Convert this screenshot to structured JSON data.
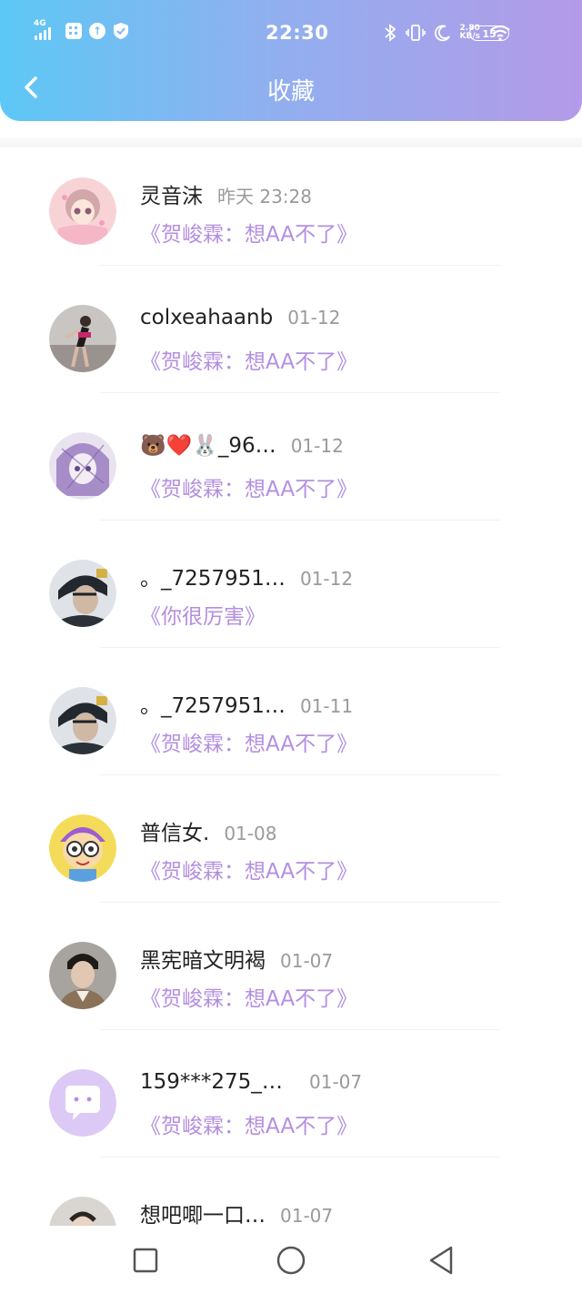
{
  "status_bar": {
    "network": "4G",
    "time": "22:30",
    "net_speed_value": "2.80",
    "net_speed_unit": "KB/s",
    "battery": "15"
  },
  "header": {
    "title": "收藏"
  },
  "items": [
    {
      "name": "灵音沫",
      "time": "昨天 23:28",
      "work": "《贺峻霖：想AA不了》"
    },
    {
      "name": "colxeahaanb",
      "time": "01-12",
      "work": "《贺峻霖：想AA不了》"
    },
    {
      "name": "🐻❤️🐰_96…",
      "time": "01-12",
      "work": "《贺峻霖：想AA不了》"
    },
    {
      "name": "。_7257951…",
      "time": "01-12",
      "work": "《你很厉害》"
    },
    {
      "name": "。_7257951…",
      "time": "01-11",
      "work": "《贺峻霖：想AA不了》"
    },
    {
      "name": "普信女.",
      "time": "01-08",
      "work": "《贺峻霖：想AA不了》"
    },
    {
      "name": "黑宪暗文明褐",
      "time": "01-07",
      "work": "《贺峻霖：想AA不了》"
    },
    {
      "name": "159***275_5…",
      "time": "01-07",
      "work": "《贺峻霖：想AA不了》"
    },
    {
      "name": "想吧唧一口…",
      "time": "01-07",
      "work": ""
    }
  ],
  "colors": {
    "header_gradient_start": "#5cc8f5",
    "header_gradient_end": "#b49ae8",
    "work_title": "#b48fe0",
    "timestamp": "#9a9a9a"
  }
}
